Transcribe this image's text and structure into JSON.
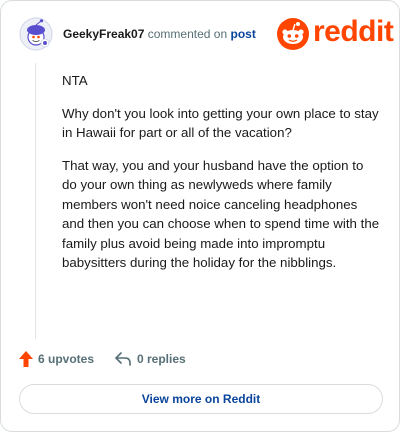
{
  "comment": {
    "author": "GeekyFreak07",
    "action_text": "commented on",
    "target_link": "post",
    "paragraphs": [
      "NTA",
      "Why don't you look into getting your own place to stay in Hawaii for part or all of the vacation?",
      "That way, you and your husband have the option to do your own thing as newlyweds where family members won't need noice canceling headphones and then you can choose when to spend time with the family plus avoid being made into impromptu babysitters during the holiday for the nibblings."
    ],
    "upvotes_label": "6 upvotes",
    "replies_label": "0 replies"
  },
  "brand": {
    "wordmark": "reddit",
    "logo_icon": "reddit-snoo-icon",
    "avatar_icon": "snoo-avatar-icon",
    "accent_color": "#ff4500",
    "link_color": "#0a449b"
  },
  "footer": {
    "view_more_label": "View more on Reddit"
  }
}
